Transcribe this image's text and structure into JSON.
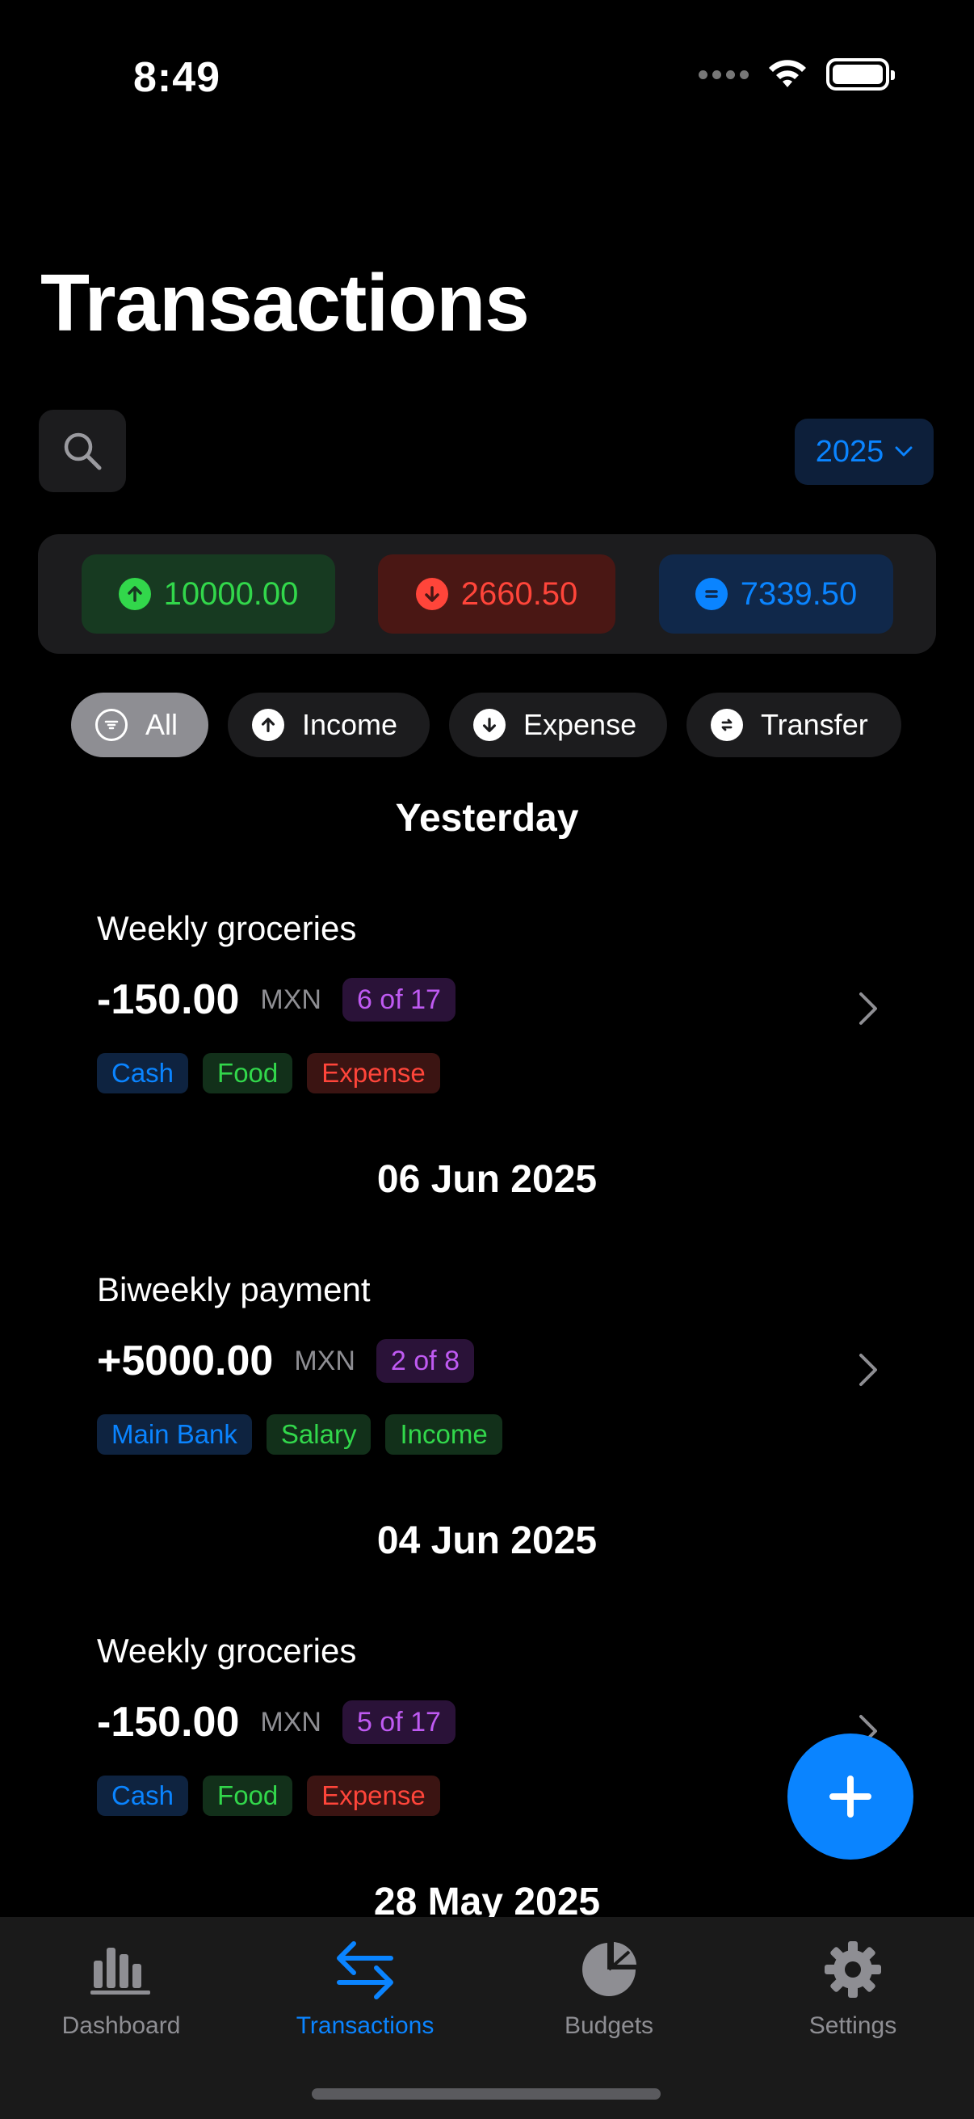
{
  "status_bar": {
    "time": "8:49"
  },
  "header": {
    "title": "Transactions"
  },
  "year_selector": {
    "value": "2025"
  },
  "summary": {
    "income": "10000.00",
    "expense": "2660.50",
    "balance": "7339.50"
  },
  "filters": [
    {
      "label": "All",
      "selected": true
    },
    {
      "label": "Income",
      "selected": false
    },
    {
      "label": "Expense",
      "selected": false
    },
    {
      "label": "Transfer",
      "selected": false
    }
  ],
  "sections": [
    {
      "header": "Yesterday",
      "transactions": [
        {
          "title": "Weekly groceries",
          "amount": "-150.00",
          "currency": "MXN",
          "installment": "6 of 17",
          "tags": [
            "Cash",
            "Food",
            "Expense"
          ]
        }
      ]
    },
    {
      "header": "06 Jun 2025",
      "transactions": [
        {
          "title": "Biweekly payment",
          "amount": "+5000.00",
          "currency": "MXN",
          "installment": "2 of 8",
          "tags": [
            "Main Bank",
            "Salary",
            "Income"
          ]
        }
      ]
    },
    {
      "header": "04 Jun 2025",
      "transactions": [
        {
          "title": "Weekly groceries",
          "amount": "-150.00",
          "currency": "MXN",
          "installment": "5 of 17",
          "tags": [
            "Cash",
            "Food",
            "Expense"
          ]
        }
      ]
    },
    {
      "header": "28 May 2025",
      "transactions": []
    }
  ],
  "tab_bar": {
    "tabs": [
      {
        "label": "Dashboard",
        "icon": "bar-chart-icon",
        "active": false
      },
      {
        "label": "Transactions",
        "icon": "arrows-left-right-icon",
        "active": true
      },
      {
        "label": "Budgets",
        "icon": "pie-chart-icon",
        "active": false
      },
      {
        "label": "Settings",
        "icon": "gear-icon",
        "active": false
      }
    ]
  },
  "colors": {
    "accent": "#0a84ff",
    "income": "#32d74b",
    "expense": "#ff453a",
    "installment": "#bf5af2"
  }
}
